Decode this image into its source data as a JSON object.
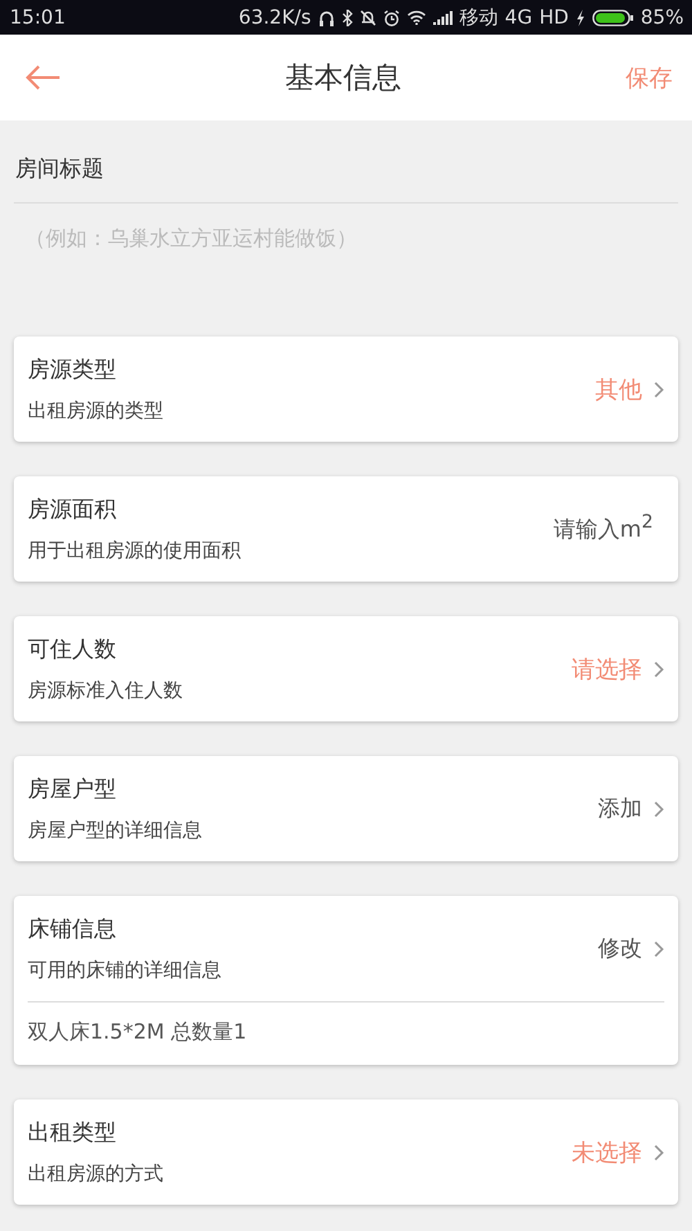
{
  "status_bar": {
    "time": "15:01",
    "speed": "63.2K/s",
    "carrier": "移动",
    "network": "4G",
    "hd": "HD",
    "battery": "85%"
  },
  "header": {
    "title": "基本信息",
    "action": "保存"
  },
  "room_title": {
    "label": "房间标题",
    "placeholder": "（例如：乌巢水立方亚运村能做饭）"
  },
  "cards": [
    {
      "title": "房源类型",
      "subtitle": "出租房源的类型",
      "value": "其他",
      "highlighted": true,
      "chevron": true
    },
    {
      "title": "房源面积",
      "subtitle": "用于出租房源的使用面积",
      "value": "请输入m$^{2}$",
      "highlighted": false,
      "chevron": false
    },
    {
      "title": "可住人数",
      "subtitle": "房源标准入住人数",
      "value": "请选择",
      "highlighted": true,
      "chevron": true
    },
    {
      "title": "房屋户型",
      "subtitle": "房屋户型的详细信息",
      "value": "添加",
      "highlighted": false,
      "chevron": true
    },
    {
      "title": "床铺信息",
      "subtitle": "可用的床铺的详细信息",
      "value": "修改",
      "highlighted": false,
      "chevron": true,
      "detail": "双人床1.5*2M  总数量1"
    },
    {
      "title": "出租类型",
      "subtitle": "出租房源的方式",
      "value": "未选择",
      "highlighted": true,
      "chevron": true
    }
  ]
}
